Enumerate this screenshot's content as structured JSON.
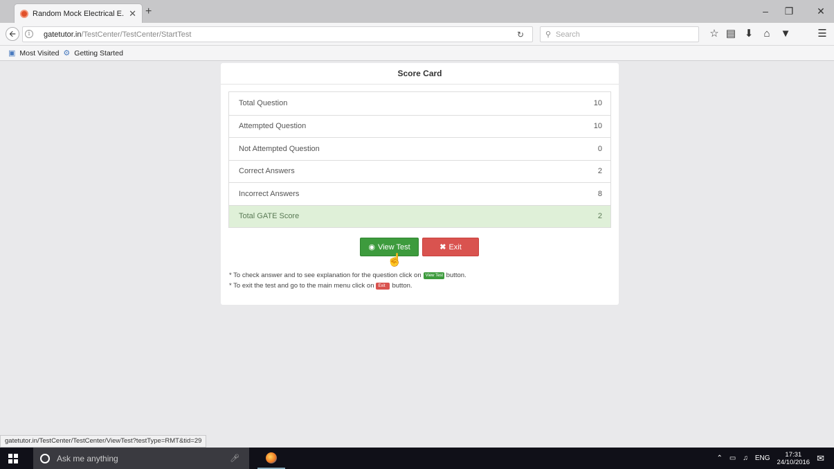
{
  "browser": {
    "tab_title": "Random Mock Electrical E...",
    "tab_close": "✕",
    "new_tab": "+",
    "url_domain": "gatetutor.in",
    "url_path": "/TestCenter/TestCenter/StartTest",
    "search_placeholder": "Search",
    "bookmarks": [
      "Most Visited",
      "Getting Started"
    ],
    "status_url": "gatetutor.in/TestCenter/TestCenter/ViewTest?testType=RMT&tid=29"
  },
  "score_card": {
    "title": "Score Card",
    "rows": [
      {
        "label": "Total Question",
        "value": "10"
      },
      {
        "label": "Attempted Question",
        "value": "10"
      },
      {
        "label": "Not Attempted Question",
        "value": "0"
      },
      {
        "label": "Correct Answers",
        "value": "2"
      },
      {
        "label": "Incorrect Answers",
        "value": "8"
      },
      {
        "label": "Total GATE Score",
        "value": "2"
      }
    ],
    "view_test_label": "View Test",
    "exit_label": "Exit",
    "note1_before": "* To check answer and to see explanation for the question click on",
    "note1_btn": "View Test",
    "note1_after": "button.",
    "note2_before": "* To exit the test and go to the main menu click on",
    "note2_btn": "Exit",
    "note2_after": "button."
  },
  "taskbar": {
    "search_placeholder": "Ask me anything",
    "language": "ENG",
    "time": "17:31",
    "date": "24/10/2016"
  },
  "colors": {
    "view_button": "#3d9b3d",
    "exit_button": "#d9534f",
    "total_row_bg": "#dff0d8"
  }
}
